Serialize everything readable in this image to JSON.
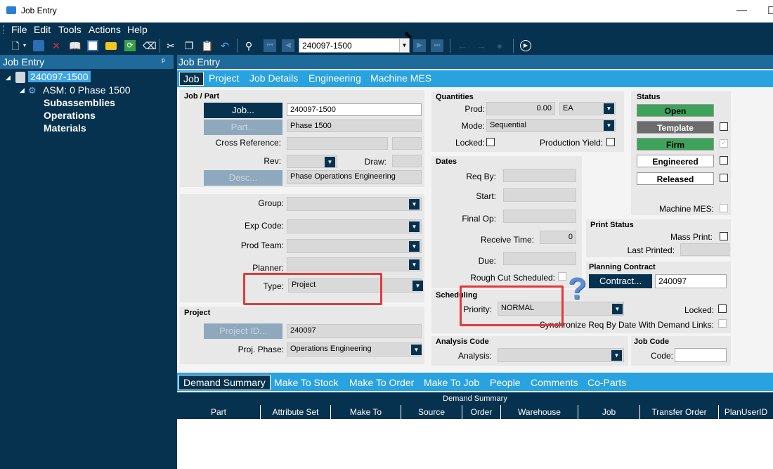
{
  "window": {
    "title": "Job Entry"
  },
  "menu": [
    "File",
    "Edit",
    "Tools",
    "Actions",
    "Help"
  ],
  "toolbar": {
    "job_value": "240097-1500"
  },
  "tree": {
    "header": "Job Entry",
    "pin": "ᵖ",
    "root": "240097-1500",
    "asm": "ASM: 0 Phase 1500",
    "children": [
      "Subassemblies",
      "Operations",
      "Materials"
    ]
  },
  "panel": {
    "header": "Job Entry"
  },
  "tabs": [
    "Job",
    "Project",
    "Job Details",
    "Engineering",
    "Machine MES"
  ],
  "job_part": {
    "title": "Job / Part",
    "job_btn": "Job...",
    "job_value": "240097-1500",
    "part_btn": "Part...",
    "part_value": "Phase 1500",
    "cross_ref_label": "Cross Reference:",
    "rev_label": "Rev:",
    "draw_label": "Draw:",
    "desc_btn": "Desc...",
    "desc_value": "Phase Operations Engineering"
  },
  "classification": {
    "group_label": "Group:",
    "exp_code_label": "Exp Code:",
    "prod_team_label": "Prod Team:",
    "planner_label": "Planner:",
    "type_label": "Type:",
    "type_value": "Project"
  },
  "project": {
    "title": "Project",
    "project_id_btn": "Project ID...",
    "project_id_value": "240097",
    "phase_label": "Proj. Phase:",
    "phase_value": "Operations Engineering"
  },
  "quantities": {
    "title": "Quantities",
    "prod_label": "Prod:",
    "prod_value": "0.00",
    "uom": "EA",
    "mode_label": "Mode:",
    "mode_value": "Sequential",
    "locked_label": "Locked:",
    "yield_label": "Production Yield:"
  },
  "dates": {
    "title": "Dates",
    "req_by_label": "Req By:",
    "start_label": "Start:",
    "final_op_label": "Final Op:",
    "receive_time_label": "Receive Time:",
    "receive_time_value": "0",
    "due_label": "Due:",
    "rough_cut_label": "Rough Cut Scheduled:"
  },
  "status": {
    "title": "Status",
    "open": "Open",
    "template": "Template",
    "firm": "Firm",
    "engineered": "Engineered",
    "released": "Released",
    "machine_mes_label": "Machine MES:"
  },
  "print_status": {
    "title": "Print Status",
    "mass_print_label": "Mass Print:",
    "last_printed_label": "Last Printed:"
  },
  "planning_contract": {
    "title": "Planning Contract",
    "contract_btn": "Contract...",
    "contract_value": "240097"
  },
  "scheduling": {
    "title": "Scheduling",
    "priority_label": "Priority:",
    "priority_value": "NORMAL",
    "locked_label": "Locked:",
    "sync_label": "Synchronize Req By Date With Demand Links:"
  },
  "analysis": {
    "title": "Analysis Code",
    "label": "Analysis:"
  },
  "job_code": {
    "title": "Job Code",
    "label": "Code:"
  },
  "bottom_tabs": [
    "Demand Summary",
    "Make To Stock",
    "Make To Order",
    "Make To Job",
    "People",
    "Comments",
    "Co-Parts"
  ],
  "grid": {
    "title": "Demand Summary",
    "columns": [
      "Part",
      "Attribute Set",
      "Make To",
      "Source",
      "Order",
      "Warehouse",
      "Job",
      "Transfer Order",
      "PlanUserID"
    ]
  },
  "colors": {
    "accent": "#29a2e0",
    "dark": "#06324f",
    "highlight": "#e23a3a",
    "status_green": "#3da35a"
  }
}
